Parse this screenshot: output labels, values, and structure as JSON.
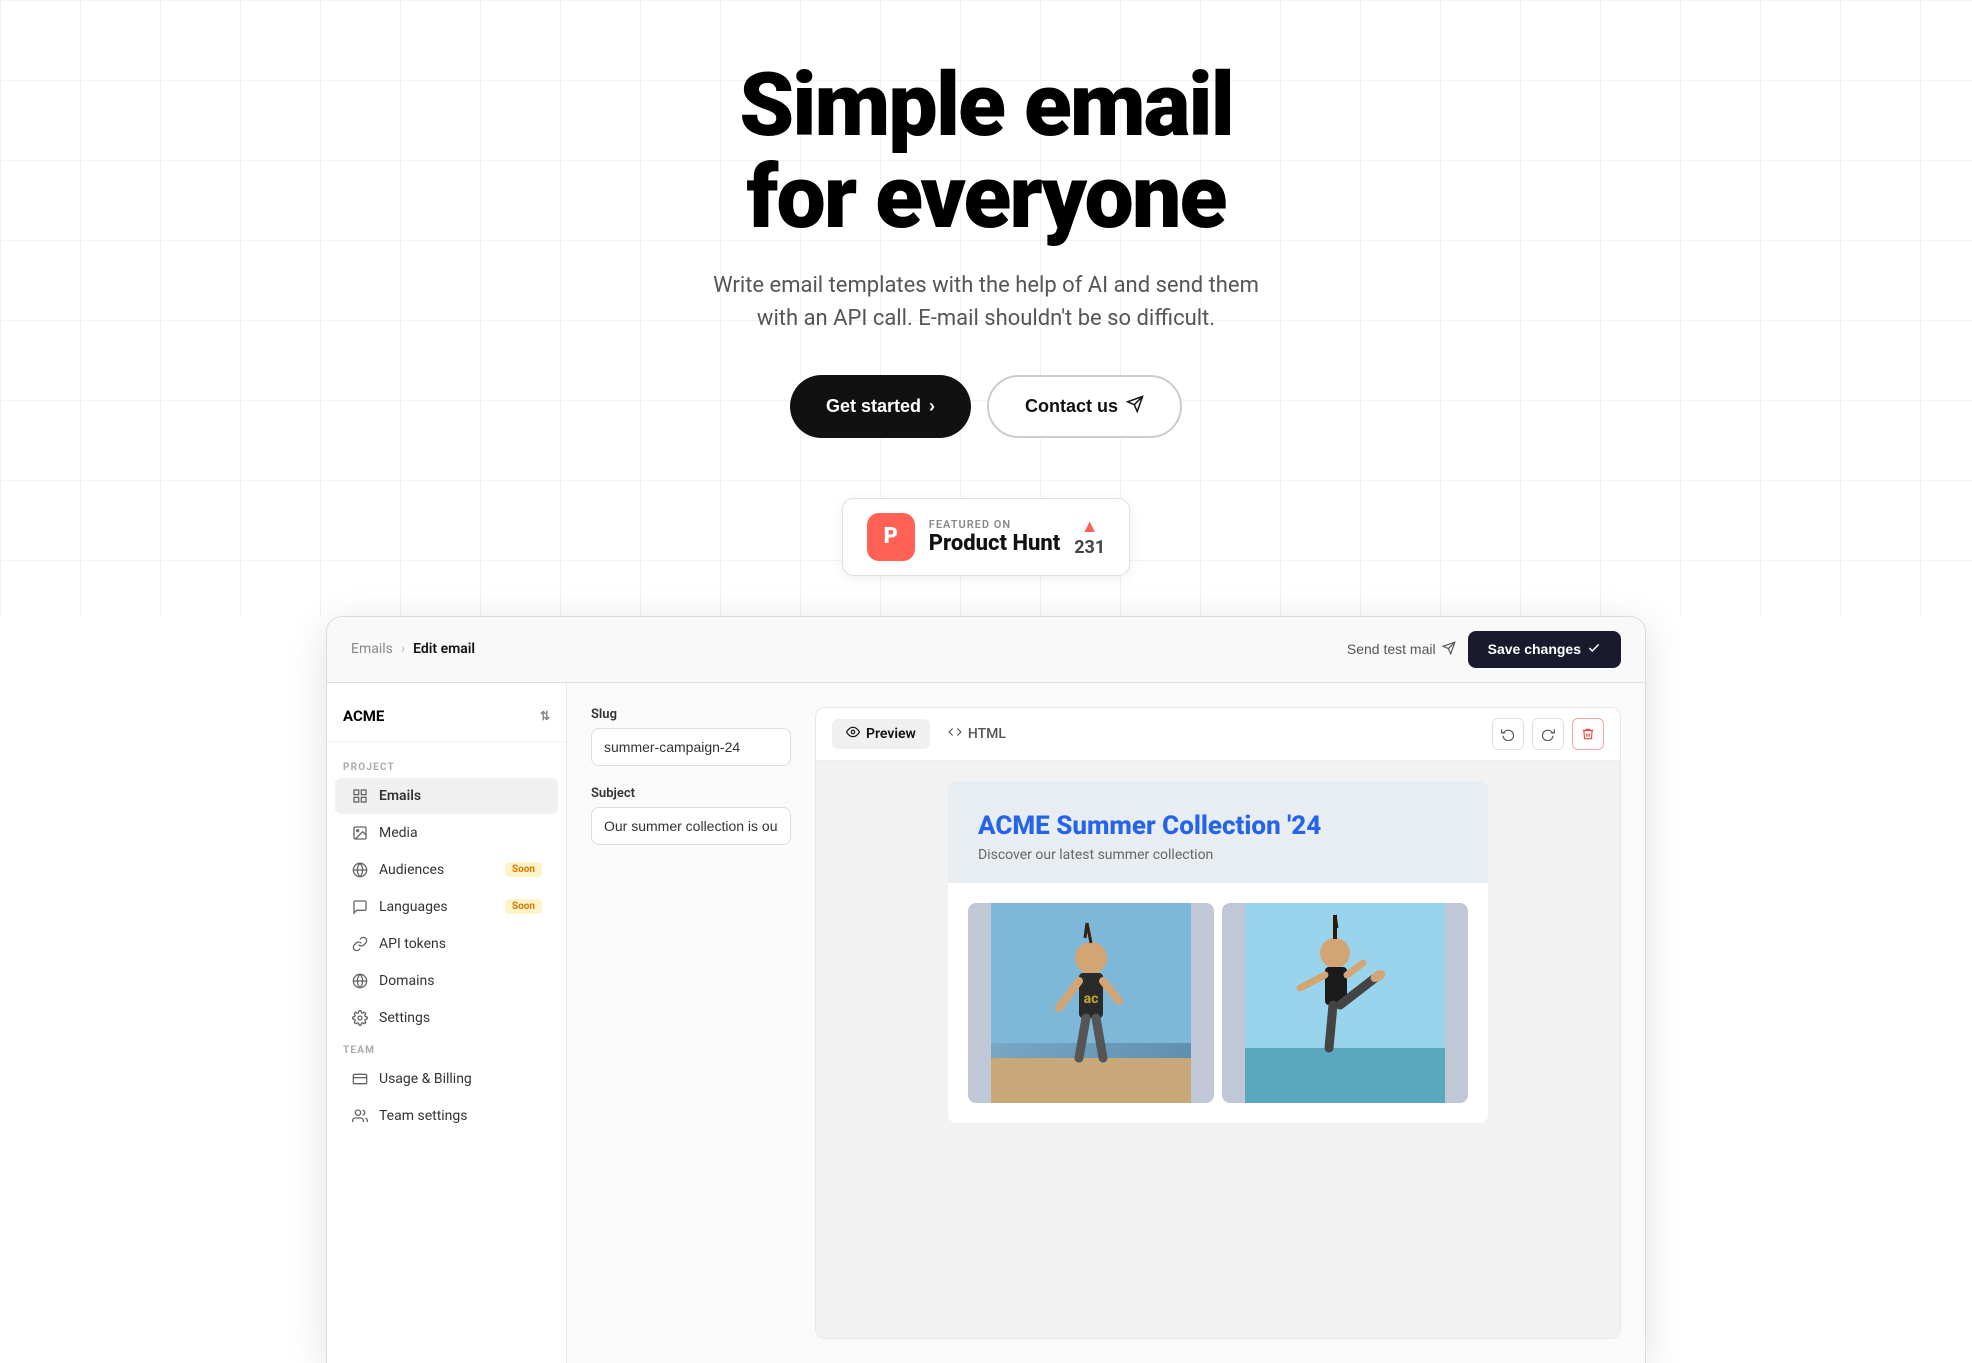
{
  "hero": {
    "title_line1": "Simple email",
    "title_line2": "for everyone",
    "subtitle_line1": "Write email templates with the help of AI and send them",
    "subtitle_line2": "with an API call. E-mail shouldn't be so difficult.",
    "btn_get_started": "Get started",
    "btn_contact_us": "Contact us",
    "ph_featured_label": "FEATURED ON",
    "ph_name": "Product Hunt",
    "ph_votes": "231"
  },
  "app": {
    "workspace_name": "ACME",
    "breadcrumb_parent": "Emails",
    "breadcrumb_current": "Edit email",
    "topbar": {
      "send_test": "Send test mail",
      "save_changes": "Save changes"
    },
    "sidebar": {
      "project_label": "PROJECT",
      "team_label": "TEAM",
      "items": [
        {
          "id": "emails",
          "label": "Emails",
          "active": true
        },
        {
          "id": "media",
          "label": "Media",
          "active": false
        },
        {
          "id": "audiences",
          "label": "Audiences",
          "active": false,
          "badge": "Soon"
        },
        {
          "id": "languages",
          "label": "Languages",
          "active": false,
          "badge": "Soon"
        },
        {
          "id": "api-tokens",
          "label": "API tokens",
          "active": false
        },
        {
          "id": "domains",
          "label": "Domains",
          "active": false
        },
        {
          "id": "settings",
          "label": "Settings",
          "active": false
        },
        {
          "id": "usage-billing",
          "label": "Usage & Billing",
          "active": false
        },
        {
          "id": "team-settings",
          "label": "Team settings",
          "active": false
        }
      ]
    },
    "form": {
      "slug_label": "Slug",
      "slug_value": "summer-campaign-24",
      "subject_label": "Subject",
      "subject_value": "Our summer collection is out now!"
    },
    "preview": {
      "tab_preview": "Preview",
      "tab_html": "HTML",
      "email_title": "ACME Summer Collection '24",
      "email_subtitle": "Discover our latest summer collection"
    }
  }
}
